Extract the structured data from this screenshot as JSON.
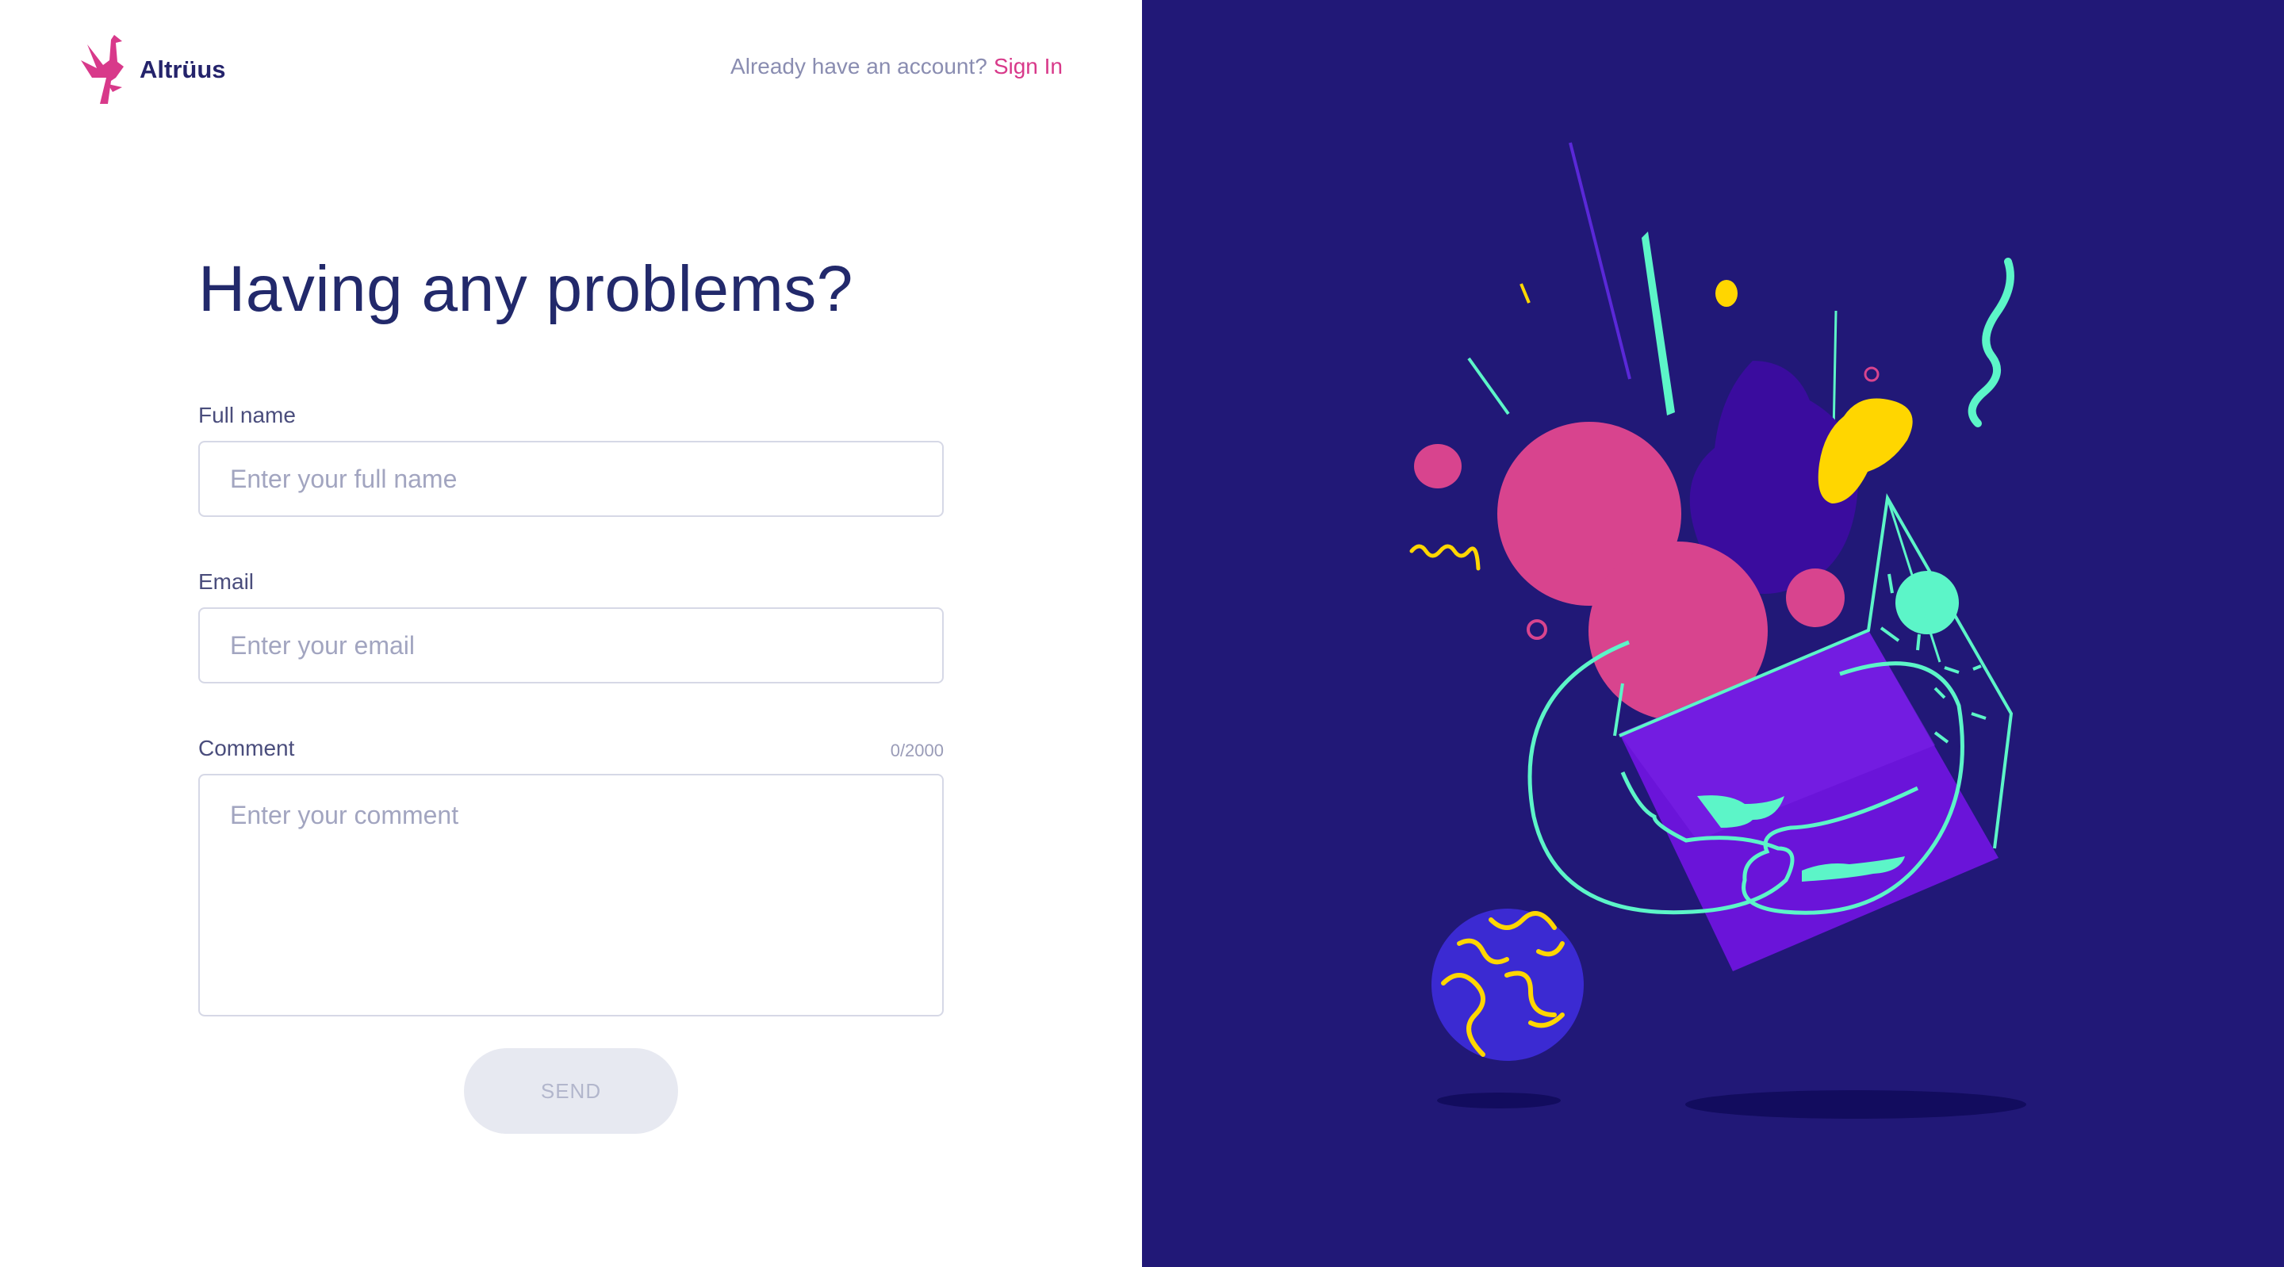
{
  "brand": {
    "name": "Altrüus",
    "logo_icon": "pink-bird-logo",
    "accent": "#d8398a"
  },
  "header": {
    "signin_prompt": "Already have an account?",
    "signin_link": "Sign In"
  },
  "form": {
    "title": "Having any problems?",
    "full_name": {
      "label": "Full name",
      "placeholder": "Enter your full name",
      "value": ""
    },
    "email": {
      "label": "Email",
      "placeholder": "Enter your email",
      "value": ""
    },
    "comment": {
      "label": "Comment",
      "placeholder": "Enter your comment",
      "value": "",
      "counter": "0/2000"
    },
    "send_label": "SEND"
  },
  "colors": {
    "panel_bg": "#211877",
    "pink": "#d8448e",
    "mint": "#5cf5c8",
    "yellow": "#ffd600",
    "violet": "#6a14d9",
    "title": "#22296b"
  }
}
